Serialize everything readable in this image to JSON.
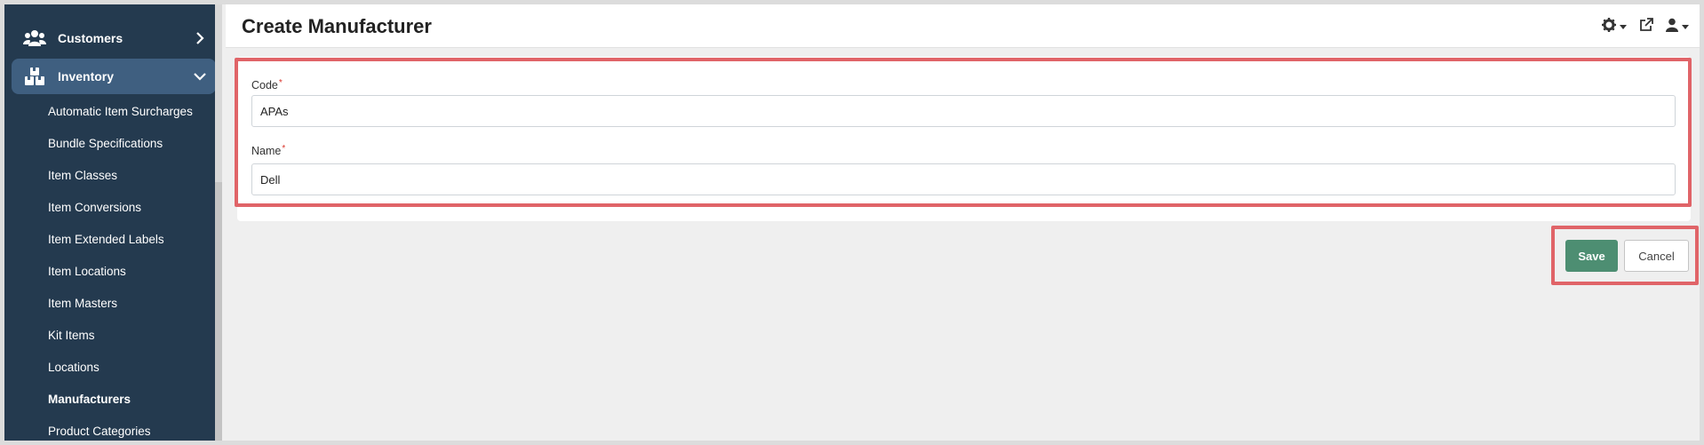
{
  "header": {
    "title": "Create Manufacturer",
    "icons": [
      "settings-icon",
      "external-link-icon",
      "user-icon"
    ]
  },
  "sidebar": {
    "sections": [
      {
        "label": "Customers",
        "icon": "users-icon",
        "expanded": false
      },
      {
        "label": "Inventory",
        "icon": "boxes-icon",
        "expanded": true
      }
    ],
    "sub_items": [
      {
        "label": "Automatic Item Surcharges"
      },
      {
        "label": "Bundle Specifications"
      },
      {
        "label": "Item Classes"
      },
      {
        "label": "Item Conversions"
      },
      {
        "label": "Item Extended Labels"
      },
      {
        "label": "Item Locations"
      },
      {
        "label": "Item Masters"
      },
      {
        "label": "Kit Items"
      },
      {
        "label": "Locations"
      },
      {
        "label": "Manufacturers",
        "active": true
      },
      {
        "label": "Product Categories"
      }
    ]
  },
  "form": {
    "code_label": "Code",
    "code_value": "APAs",
    "name_label": "Name",
    "name_value": "Dell",
    "required_marker": "*"
  },
  "actions": {
    "save_label": "Save",
    "cancel_label": "Cancel"
  },
  "colors": {
    "sidebar_bg": "#243a4f",
    "sidebar_active": "#3f5f80",
    "save_button": "#4d8e72",
    "highlight": "#e06468"
  }
}
